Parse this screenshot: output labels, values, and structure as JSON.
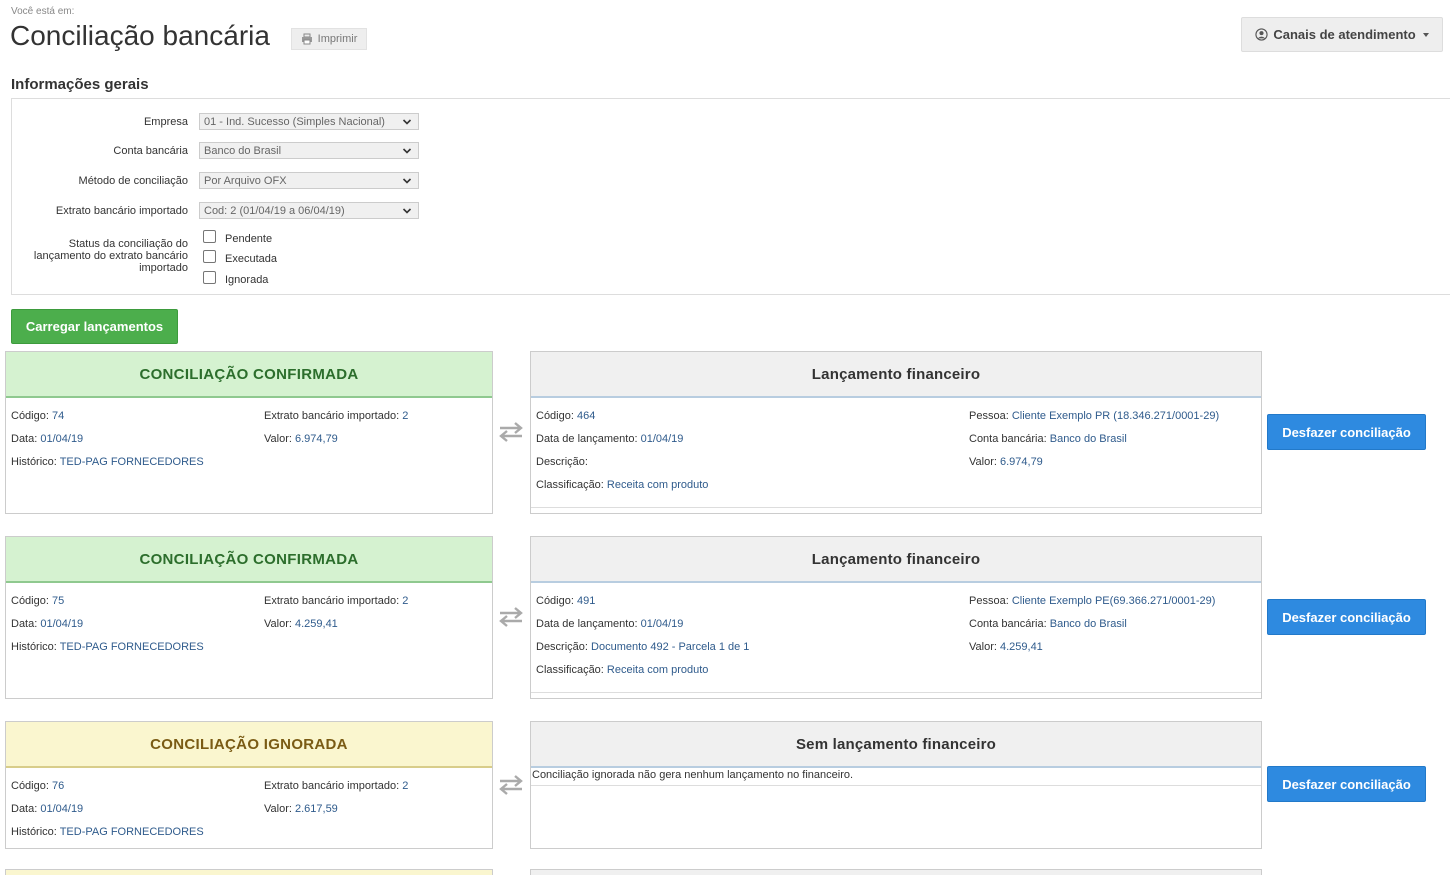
{
  "breadcrumb": "Você está em:",
  "page_title": "Conciliação bancária",
  "print_label": "Imprimir",
  "canais_label": "Canais de atendimento",
  "section_title": "Informações gerais",
  "form": {
    "empresa_label": "Empresa",
    "empresa_value": "01 - Ind. Sucesso (Simples Nacional)",
    "conta_label": "Conta bancária",
    "conta_value": "Banco do Brasil",
    "metodo_label": "Método de conciliação",
    "metodo_value": "Por Arquivo OFX",
    "extrato_label": "Extrato bancário importado",
    "extrato_value": "Cod: 2 (01/04/19 a 06/04/19)",
    "status_label": "Status da conciliação do lançamento do extrato bancário importado",
    "status_options": [
      "Pendente",
      "Executada",
      "Ignorada"
    ]
  },
  "load_button": "Carregar lançamentos",
  "undo_button": "Desfazer conciliação",
  "labels": {
    "codigo": "Código:",
    "data": "Data:",
    "historico": "Histórico:",
    "extrato": "Extrato bancário importado:",
    "valor": "Valor:",
    "data_lancamento": "Data de lançamento:",
    "descricao": "Descrição:",
    "classificacao": "Classificação:",
    "pessoa": "Pessoa:",
    "conta": "Conta bancária:"
  },
  "reconciliations": [
    {
      "status": "CONCILIAÇÃO CONFIRMADA",
      "status_color": "#2c6e2c",
      "codigo": "74",
      "data": "01/04/19",
      "historico": "TED-PAG FORNECEDORES",
      "extrato": "2",
      "valor": "6.974,79",
      "fin_title": "Lançamento financeiro",
      "fin_codigo": "464",
      "fin_data": "01/04/19",
      "fin_descricao": "",
      "fin_classificacao": "Receita com produto",
      "fin_pessoa": "Cliente Exemplo PR (18.346.271/0001-29)",
      "fin_conta": "Banco do Brasil",
      "fin_valor": "6.974,79"
    },
    {
      "status": "CONCILIAÇÃO CONFIRMADA",
      "status_color": "#2c6e2c",
      "codigo": "75",
      "data": "01/04/19",
      "historico": "TED-PAG FORNECEDORES",
      "extrato": "2",
      "valor": "4.259,41",
      "fin_title": "Lançamento financeiro",
      "fin_codigo": "491",
      "fin_data": "01/04/19",
      "fin_descricao": "Documento 492 - Parcela 1 de 1",
      "fin_classificacao": "Receita com produto",
      "fin_pessoa": "Cliente Exemplo PE(69.366.271/0001-29)",
      "fin_conta": "Banco do Brasil",
      "fin_valor": "4.259,41"
    },
    {
      "status": "CONCILIAÇÃO IGNORADA",
      "status_color": "#7a5b14",
      "codigo": "76",
      "data": "01/04/19",
      "historico": "TED-PAG FORNECEDORES",
      "extrato": "2",
      "valor": "2.617,59",
      "fin_title": "Sem lançamento financeiro",
      "fin_note": "Conciliação ignorada não gera nenhum lançamento no financeiro."
    }
  ],
  "colors": {
    "confirmed_bg": "#d5f2d0",
    "ignored_bg": "#faf6cf",
    "primary_button": "#2e8ae0",
    "success_button": "#4cae4c",
    "link_value": "#2f5b8c"
  },
  "icons": {
    "print": "printer-icon",
    "canais": "user-circle-icon",
    "dropdown": "chevron-down-icon",
    "arrows": "exchange-arrows-icon"
  }
}
